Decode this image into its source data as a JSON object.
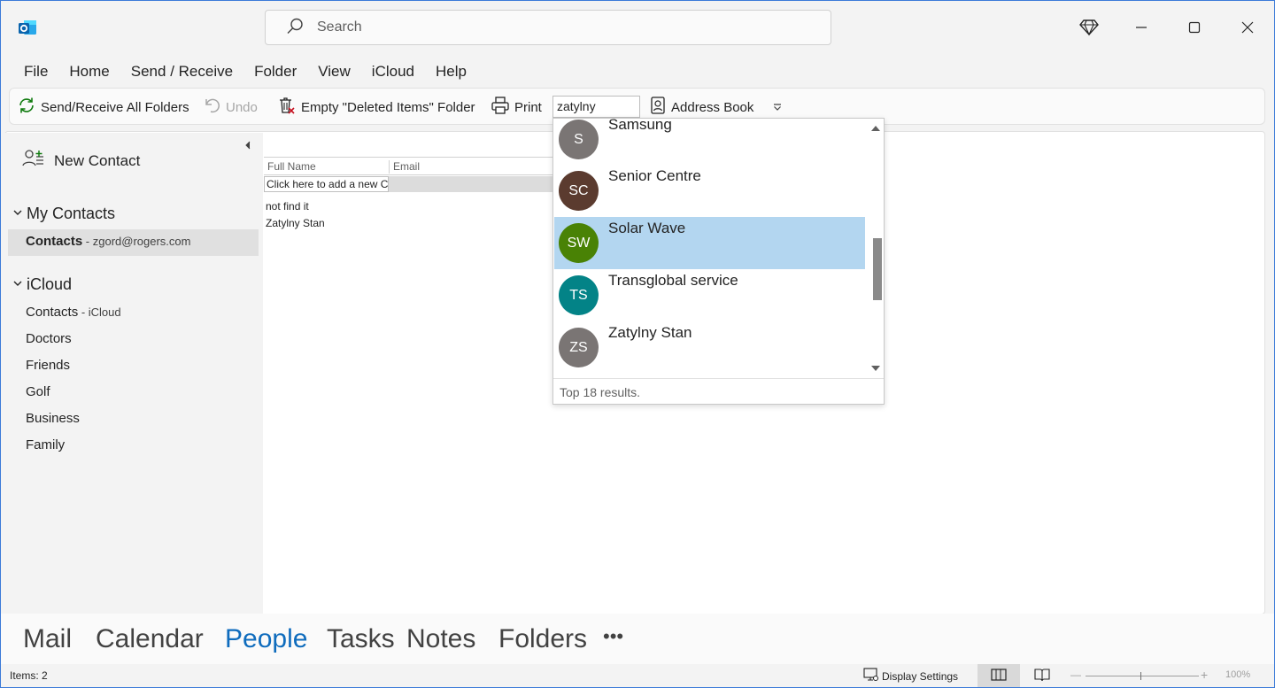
{
  "app": {
    "icon": "outlook-icon"
  },
  "search": {
    "placeholder": "Search"
  },
  "window_controls": {
    "premium": "diamond-icon",
    "minimize": "minimize-icon",
    "maximize": "maximize-icon",
    "close": "close-icon"
  },
  "menu": [
    "File",
    "Home",
    "Send / Receive",
    "Folder",
    "View",
    "iCloud",
    "Help"
  ],
  "ribbon": {
    "send_receive": "Send/Receive All Folders",
    "undo": "Undo",
    "empty_deleted": "Empty \"Deleted Items\" Folder",
    "print": "Print",
    "search_people_value": "zatylny",
    "address_book": "Address Book"
  },
  "nav": {
    "new_contact": "New Contact",
    "my_contacts": "My Contacts",
    "contacts_label": "Contacts",
    "contacts_sub": " - zgord@rogers.com",
    "icloud": "iCloud",
    "icloud_contacts": "Contacts",
    "icloud_contacts_sub": " - iCloud",
    "folders": [
      "Doctors",
      "Friends",
      "Golf",
      "Business",
      "Family"
    ]
  },
  "table": {
    "col_full_name": "Full Name",
    "col_email": "Email",
    "add_new": "Click here to add a new Contact",
    "rows": [
      "not find it",
      "Zatylny Stan"
    ]
  },
  "dropdown": {
    "items": [
      {
        "initials": "S",
        "name": "Samsung",
        "color": "#7a7574"
      },
      {
        "initials": "SC",
        "name": "Senior Centre",
        "color": "#5b3b2f"
      },
      {
        "initials": "SW",
        "name": "Solar Wave",
        "color": "#498205"
      },
      {
        "initials": "TS",
        "name": "Transglobal service",
        "color": "#038387"
      },
      {
        "initials": "ZS",
        "name": "Zatylny Stan",
        "color": "#7a7574"
      }
    ],
    "selected_index": 2,
    "footer": "Top 18 results."
  },
  "bottom_nav": [
    "Mail",
    "Calendar",
    "People",
    "Tasks",
    "Notes",
    "Folders",
    "•••"
  ],
  "bottom_nav_active": "People",
  "status": {
    "items": "Items: 2",
    "display_settings": "Display Settings",
    "zoom": "100%"
  },
  "colors": {
    "accent": "#0f6cbd",
    "selected_row": "#b3d6f0"
  }
}
